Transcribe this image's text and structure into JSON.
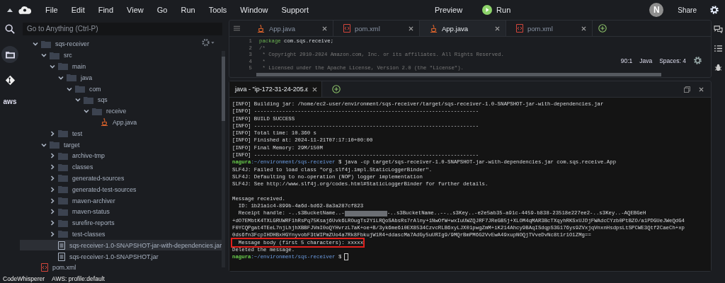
{
  "menubar": {
    "items": [
      "File",
      "Edit",
      "Find",
      "View",
      "Go",
      "Run",
      "Tools",
      "Window",
      "Support"
    ],
    "preview": "Preview",
    "run": "Run",
    "avatar": "N",
    "share": "Share"
  },
  "rail": {
    "items": [
      {
        "kind": "search",
        "selected": false
      },
      {
        "kind": "folder",
        "selected": true
      },
      {
        "kind": "git",
        "selected": false
      },
      {
        "kind": "aws",
        "label": "aws",
        "selected": false
      }
    ]
  },
  "explorer": {
    "search": {
      "placeholder": "Go to Anything (Ctrl-P)"
    },
    "tree": [
      {
        "name": "sqs-receiver",
        "kind": "folder",
        "expanded": true,
        "selected": false,
        "children": [
          {
            "name": "src",
            "kind": "folder",
            "expanded": true,
            "selected": false,
            "children": [
              {
                "name": "main",
                "kind": "folder",
                "expanded": true,
                "selected": false,
                "children": [
                  {
                    "name": "java",
                    "kind": "folder",
                    "expanded": true,
                    "selected": false,
                    "children": [
                      {
                        "name": "com",
                        "kind": "folder",
                        "expanded": true,
                        "selected": false,
                        "children": [
                          {
                            "name": "sqs",
                            "kind": "folder",
                            "expanded": true,
                            "selected": false,
                            "children": [
                              {
                                "name": "receive",
                                "kind": "folder",
                                "expanded": true,
                                "selected": false,
                                "children": [
                                  {
                                    "name": "App.java",
                                    "kind": "java",
                                    "selected": false
                                  }
                                ]
                              }
                            ]
                          }
                        ]
                      }
                    ]
                  }
                ]
              },
              {
                "name": "test",
                "kind": "folder",
                "expanded": false,
                "selected": false
              }
            ]
          },
          {
            "name": "target",
            "kind": "folder",
            "expanded": true,
            "selected": false,
            "children": [
              {
                "name": "archive-tmp",
                "kind": "folder",
                "expanded": false,
                "selected": false
              },
              {
                "name": "classes",
                "kind": "folder",
                "expanded": false,
                "selected": false
              },
              {
                "name": "generated-sources",
                "kind": "folder",
                "expanded": false,
                "selected": false
              },
              {
                "name": "generated-test-sources",
                "kind": "folder",
                "expanded": false,
                "selected": false
              },
              {
                "name": "maven-archiver",
                "kind": "folder",
                "expanded": false,
                "selected": false
              },
              {
                "name": "maven-status",
                "kind": "folder",
                "expanded": false,
                "selected": false
              },
              {
                "name": "surefire-reports",
                "kind": "folder",
                "expanded": false,
                "selected": false
              },
              {
                "name": "test-classes",
                "kind": "folder",
                "expanded": false,
                "selected": false
              },
              {
                "name": "sqs-receiver-1.0-SNAPSHOT-jar-with-dependencies.jar",
                "kind": "jar",
                "selected": true
              },
              {
                "name": "sqs-receiver-1.0-SNAPSHOT.jar",
                "kind": "jar",
                "selected": false
              }
            ]
          },
          {
            "name": "pom.xml",
            "kind": "xml",
            "selected": false
          }
        ]
      }
    ]
  },
  "editor": {
    "tabs": [
      {
        "label": "App.java",
        "kind": "java",
        "selected": false
      },
      {
        "label": "pom.xml",
        "kind": "xml",
        "selected": false
      },
      {
        "label": "App.java",
        "kind": "java",
        "selected": true
      },
      {
        "label": "pom.xml",
        "kind": "xml",
        "selected": false
      }
    ],
    "lines": [
      {
        "number": "1",
        "text": "com.sqs.receive;",
        "keyword": "package"
      },
      {
        "number": "2",
        "text": "/*"
      },
      {
        "number": "3",
        "text": " * Copyright 2010-2024 Amazon.com, Inc. or its affiliates. All Rights Reserved."
      },
      {
        "number": "4",
        "text": " *"
      },
      {
        "number": "5",
        "text": " * Licensed under the Apache License, Version 2.0 (the \"License\")."
      }
    ],
    "status": {
      "position": "90:1",
      "language": "Java",
      "indent": "Spaces: 4"
    }
  },
  "terminal": {
    "tab": "java - \"ip-172-31-24-205.ε",
    "lines": [
      {
        "kind": "plain",
        "text": "[INFO] Building jar: /home/ec2-user/environment/sqs-receiver/target/sqs-receiver-1.0-SNAPSHOT-jar-with-dependencies.jar"
      },
      {
        "kind": "plain",
        "text": "[INFO] ------------------------------------------------------------------------"
      },
      {
        "kind": "plain",
        "text": "[INFO] BUILD SUCCESS"
      },
      {
        "kind": "plain",
        "text": "[INFO] ------------------------------------------------------------------------"
      },
      {
        "kind": "plain",
        "text": "[INFO] Total time: 10.360 s"
      },
      {
        "kind": "plain",
        "text": "[INFO] Finished at: 2024-11-21T07:17:10+00:00"
      },
      {
        "kind": "plain",
        "text": "[INFO] Final Memory: 29M/150M"
      },
      {
        "kind": "plain",
        "text": "[INFO] ------------------------------------------------------------------------"
      },
      {
        "kind": "prompt",
        "user": "nagura",
        "path": ":~/environment/sqs-receiver",
        "command": "$ java -cp target/sqs-receiver-1.0-SNAPSHOT-jar-with-dependencies.jar com.sqs.receive.App"
      },
      {
        "kind": "plain",
        "text": "SLF4J: Failed to load class \"org.slf4j.impl.StaticLoggerBinder\"."
      },
      {
        "kind": "plain",
        "text": "SLF4J: Defaulting to no-operation (NOP) logger implementation"
      },
      {
        "kind": "plain",
        "text": "SLF4J: See http://www.slf4j.org/codes.html#StaticLoggerBinder for further details."
      },
      {
        "kind": "blank"
      },
      {
        "kind": "plain",
        "text": "Message received."
      },
      {
        "kind": "plain",
        "text": "  ID: 1b21a1c4-899b-4a6d-bd62-8a3a287cf823"
      },
      {
        "kind": "receipt",
        "before": "  Receipt handle: -..s3BucketName..-",
        "after": "-..s3BucketName..--..s3Key..-e2e5ab35-a91c-4459-b838-23518e227ee2-..s3Key..-AQEBGeH"
      },
      {
        "kind": "plain",
        "text": "+dO7EMbtK4TXLGRUWRF1hRsPq75Ksaj6Uvk6LROugTs2Y1LRQoSAbsRs7rAlny+1NwOfW+wxIuUWZQJRF7JReGB5j+XLOM4qMAR3BcTXqyhRKSxUJDjFWAdcCYzb0PtBZO/a1PDGUeJWeQdG4"
      },
      {
        "kind": "plain",
        "text": "F0YCQPgat4TEeL7njLhjhXBBFJVmI0oQYHvrzL7aK+oe+B/3yk6me6i0EX8534CzvcRLB6xyLJX01pwgZmM+iK214Ahcy9BAqISdqpS3G176ys9ZVxjqVnxnHsdpsLtSPCWE3Qtf2CaeCh+xp"
      },
      {
        "kind": "plain",
        "text": "0ds6fn3FcpIHDHBxHGYnyvobF3tWIPmZUo4a7Rk8FbkujW1R4+ddascMa7AdGy5uURIg9/9MQrBmPM6G2VvEwA49xupNOQjTVveDvNc8t1r1O1ZMg=="
      },
      {
        "kind": "highlight",
        "text": "  Message body (first 5 characters): xxxxx"
      },
      {
        "kind": "plain",
        "text": "Deleted the message."
      },
      {
        "kind": "prompt",
        "user": "nagura",
        "path": ":~/environment/sqs-receiver",
        "command": "$"
      }
    ]
  },
  "status_bar": {
    "items": [
      "CodeWhisperer",
      "AWS: profile:default"
    ]
  }
}
